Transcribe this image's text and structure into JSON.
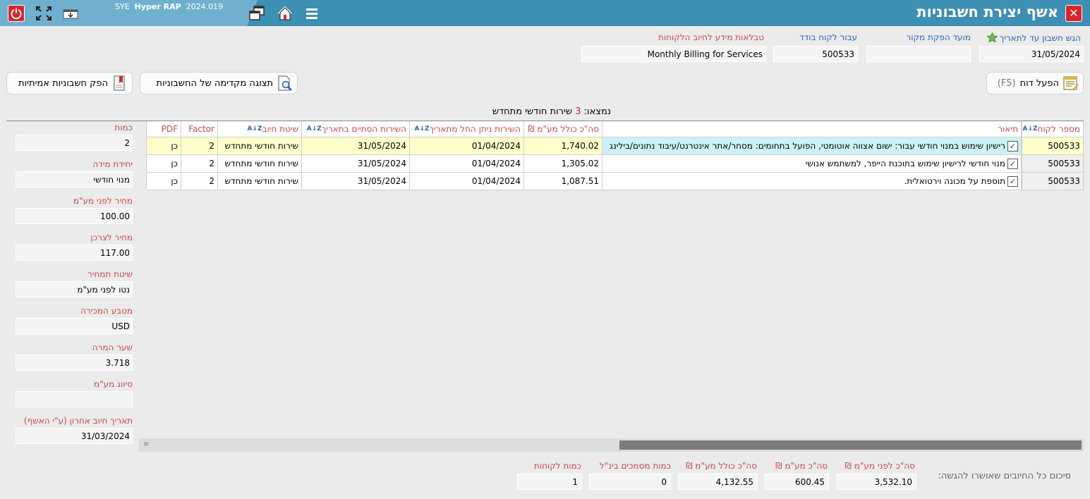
{
  "window": {
    "title": "אשף יצירת חשבוניות",
    "app_name_prefix": "SYE",
    "app_name": "Hyper RAP",
    "app_version": "2024.019"
  },
  "params": {
    "date_label": "הגש חשבון עד לתאריך",
    "date_value": "31/05/2024",
    "source_label": "מועד הפקת מקור",
    "source_value": "",
    "customer_label": "עבור לקוח בודד",
    "customer_value": "500533",
    "table_label": "טבלאות מידע לחיוב הלקוחות",
    "table_value": "Monthly Billing for Services"
  },
  "actions": {
    "run_report": "הפעל דוח",
    "run_report_key": "(F5)",
    "preview": "תצוגה מקדימה של החשבוניות",
    "issue": "הפק חשבוניות אמיתיות"
  },
  "found": {
    "prefix": "נמצאו:",
    "count": "3",
    "suffix": "שירות חודשי מתחדש"
  },
  "grid": {
    "headers": {
      "customer": "מספר לקוח",
      "description": "תיאור",
      "total": "סה\"כ כולל מע\"מ ₪",
      "from": "השירות ניתן החל מתאריך",
      "to": "השירות הסתיים בתאריך",
      "method": "שיטת חיוב",
      "factor": "Factor",
      "pdf": "PDF"
    },
    "rows": [
      {
        "customer": "500533",
        "description": "רישיון שימוש במנוי חודשי עבור: ישום אצווה אוטומטי, הפועל בתחומים: מסחר/אתר אינטרנט/עיבוד נתונים/בילינג",
        "total": "1,740.02",
        "from": "01/04/2024",
        "to": "31/05/2024",
        "method": "שירות חודשי מתחדש",
        "factor": "2",
        "pdf": "כן",
        "checked": "✓"
      },
      {
        "customer": "500533",
        "description": "מנוי חודשי לרישיון שימוש בתוכנת הייפר, למשתמש אנושי",
        "total": "1,305.02",
        "from": "01/04/2024",
        "to": "31/05/2024",
        "method": "שירות חודשי מתחדש",
        "factor": "2",
        "pdf": "כן",
        "checked": "✓"
      },
      {
        "customer": "500533",
        "description": "תוספת על מכונה וירטואלית.",
        "total": "1,087.51",
        "from": "01/04/2024",
        "to": "31/05/2024",
        "method": "שירות חודשי מתחדש",
        "factor": "2",
        "pdf": "כן",
        "checked": "✓"
      }
    ]
  },
  "side": [
    {
      "label": "כמות",
      "value": "2",
      "num": true
    },
    {
      "label": "יחידת מידה",
      "value": "מנוי חודשי",
      "num": false
    },
    {
      "label": "מחיר לפני מע\"מ",
      "value": "100.00",
      "num": true
    },
    {
      "label": "מחיר לצרכן",
      "value": "117.00",
      "num": true
    },
    {
      "label": "שיטת תמחיר",
      "value": "נטו לפני מע\"מ",
      "num": false
    },
    {
      "label": "מטבע המכירה",
      "value": "USD",
      "num": true
    },
    {
      "label": "שער המרה",
      "value": "3.718",
      "num": true
    },
    {
      "label": "סיווג מע\"מ",
      "value": "",
      "num": false
    },
    {
      "label": "תאריך חיוב אחרון (ע\"י האשף)",
      "value": "31/03/2024",
      "num": true
    }
  ],
  "summary": {
    "title": "סיכום כל החיובים שאושרו להגשה:",
    "before_vat_label": "סה\"כ לפני מע\"מ ₪",
    "before_vat": "3,532.10",
    "vat_label": "סה\"כ מע\"מ ₪",
    "vat": "600.45",
    "total_label": "סה\"כ כולל מע\"מ ₪",
    "total": "4,132.55",
    "intl_docs_label": "כמות מסמכים בינ\"ל",
    "intl_docs": "0",
    "customers_label": "כמות לקוחות",
    "customers": "1"
  },
  "colors": {
    "titlebar": "#3d8fb3",
    "label_red": "#c94a4a",
    "label_blue": "#2a63b7",
    "selected_row": "#ffffcc",
    "selected_desc": "#ccf2f7"
  }
}
